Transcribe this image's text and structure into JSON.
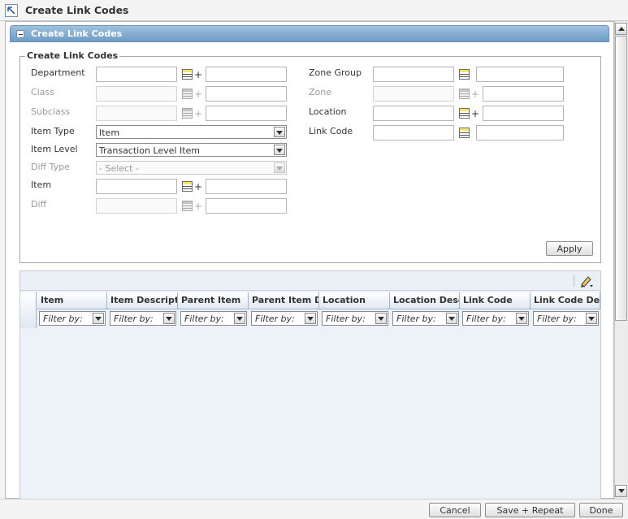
{
  "window": {
    "title": "Create Link Codes"
  },
  "section": {
    "title": "Create Link Codes"
  },
  "group": {
    "title": "Create Link Codes"
  },
  "form": {
    "department": {
      "label": "Department",
      "value": "",
      "desc": ""
    },
    "class": {
      "label": "Class",
      "value": "",
      "desc": ""
    },
    "subclass": {
      "label": "Subclass",
      "value": "",
      "desc": ""
    },
    "item_type": {
      "label": "Item Type",
      "value": "Item"
    },
    "item_level": {
      "label": "Item Level",
      "value": "Transaction Level Item"
    },
    "diff_type": {
      "label": "Diff Type",
      "value": "- Select -"
    },
    "item": {
      "label": "Item",
      "value": "",
      "desc": ""
    },
    "diff": {
      "label": "Diff",
      "value": "",
      "desc": ""
    },
    "zone_group": {
      "label": "Zone Group",
      "value": "",
      "desc": ""
    },
    "zone": {
      "label": "Zone",
      "value": "",
      "desc": ""
    },
    "location": {
      "label": "Location",
      "value": "",
      "desc": ""
    },
    "link_code": {
      "label": "Link Code",
      "value": "",
      "desc": ""
    },
    "plus_sign": "+",
    "apply_label": "Apply"
  },
  "table": {
    "columns": [
      {
        "label": "Item"
      },
      {
        "label": "Item Description"
      },
      {
        "label": "Parent Item"
      },
      {
        "label": "Parent Item Description"
      },
      {
        "label": "Location"
      },
      {
        "label": "Location Description"
      },
      {
        "label": "Link Code"
      },
      {
        "label": "Link Code Description"
      }
    ],
    "filter_placeholder": "Filter by:"
  },
  "footer": {
    "cancel_label": "Cancel",
    "save_repeat_label": "Save + Repeat",
    "done_label": "Done"
  },
  "icons": {
    "title": "arrow-up-left-icon",
    "collapse": "collapse-minus-icon",
    "lov": "list-of-values-icon",
    "edit": "pencil-edit-icon"
  },
  "colors": {
    "section_header": "#7fa8cd",
    "table_bg": "#edf2f8",
    "lov_accent": "#fbe46a"
  }
}
